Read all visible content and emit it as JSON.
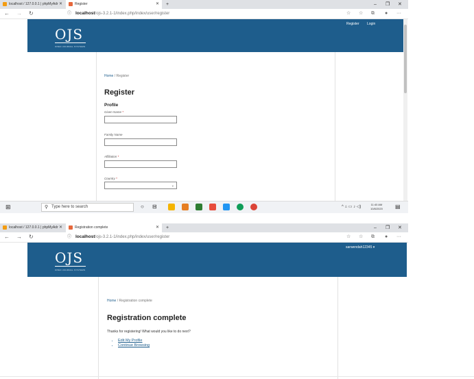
{
  "screen1": {
    "tabs": [
      {
        "label": "localhost / 127.0.0.1 | phpMyAdr"
      },
      {
        "label": "Register"
      }
    ],
    "url_host": "localhost",
    "url_path": "/ojs-3.2.1-1/index.php/index/user/register",
    "header": {
      "logo": "OJS",
      "logo_sub": "OPEN JOURNAL SYSTEMS",
      "register_link": "Register",
      "login_link": "Login"
    },
    "breadcrumb": {
      "home": "Home",
      "sep": "/",
      "current": "Register"
    },
    "page_title": "Register",
    "section_title": "Profile",
    "fields": [
      {
        "label": "Given Name",
        "required": "*"
      },
      {
        "label": "Family Name",
        "required": ""
      },
      {
        "label": "Affiliation",
        "required": "*"
      },
      {
        "label": "Country",
        "required": "*"
      }
    ],
    "taskbar": {
      "search_placeholder": "Type here to search",
      "time": "11:40 AM",
      "date": "10/8/2020"
    }
  },
  "screen2": {
    "tabs": [
      {
        "label": "localhost / 127.0.0.1 | phpMyAdr"
      },
      {
        "label": "Registration complete"
      }
    ],
    "url_host": "localhost",
    "url_path": "/ojs-3.2.1-1/index.php/index/user/register",
    "header": {
      "logo": "OJS",
      "logo_sub": "OPEN JOURNAL SYSTEMS",
      "user_menu": "sarwendah12345 ▾"
    },
    "breadcrumb": {
      "home": "Home",
      "sep": "/",
      "current": "Registration complete"
    },
    "page_title": "Registration complete",
    "message": "Thanks for registering! What would you like to do next?",
    "links": [
      "Edit My Profile",
      "Continue Browsing"
    ]
  },
  "colors": {
    "header": "#1e5d8c",
    "link": "#1e5d8c",
    "required": "#c62828"
  }
}
